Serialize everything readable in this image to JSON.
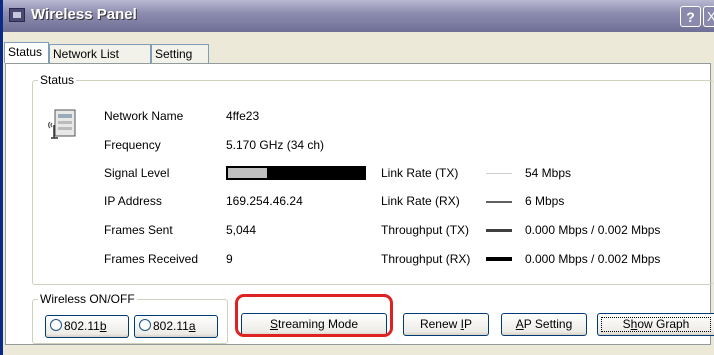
{
  "window": {
    "title": "Wireless Panel",
    "help_label": "?",
    "close_label": "X"
  },
  "tabs": [
    {
      "label": "Status"
    },
    {
      "label": "Network List"
    },
    {
      "label": "Setting"
    }
  ],
  "status_group": {
    "label": "Status"
  },
  "status": {
    "network_name_label": "Network Name",
    "network_name_value": "4ffe23",
    "frequency_label": "Frequency",
    "frequency_value": "5.170 GHz (34 ch)",
    "signal_level_label": "Signal Level",
    "signal_level_fraction": 0.29,
    "ip_address_label": "IP Address",
    "ip_address_value": "169.254.46.24",
    "frames_sent_label": "Frames Sent",
    "frames_sent_value": "5,044",
    "frames_received_label": "Frames Received",
    "frames_received_value": "9",
    "link_rate_tx_label": "Link Rate (TX)",
    "link_rate_tx_value": "54 Mbps",
    "link_rate_rx_label": "Link Rate (RX)",
    "link_rate_rx_value": "6 Mbps",
    "throughput_tx_label": "Throughput (TX)",
    "throughput_tx_value": "0.000 Mbps / 0.002 Mbps",
    "throughput_rx_label": "Throughput (RX)",
    "throughput_rx_value": "0.000 Mbps / 0.002 Mbps"
  },
  "wireless_group": {
    "label": "Wireless ON/OFF"
  },
  "radios": [
    {
      "label_prefix": "802.11",
      "label_accel": "b"
    },
    {
      "label_prefix": "802.11",
      "label_accel": "a"
    }
  ],
  "buttons": {
    "streaming_accel": "S",
    "streaming_rest": "treaming Mode",
    "renew_prefix": "Renew ",
    "renew_accel": "I",
    "renew_suffix": "P",
    "ap_accel": "A",
    "ap_rest": "P Setting",
    "graph_prefix": "S",
    "graph_accel": "h",
    "graph_rest": "ow Graph"
  },
  "colors": {
    "highlight": "#e02222",
    "link_rate_tx_legend": "#d0d0d0",
    "link_rate_rx_legend": "#606060",
    "throughput_tx_legend": "#404040",
    "throughput_rx_legend": "#000000"
  }
}
